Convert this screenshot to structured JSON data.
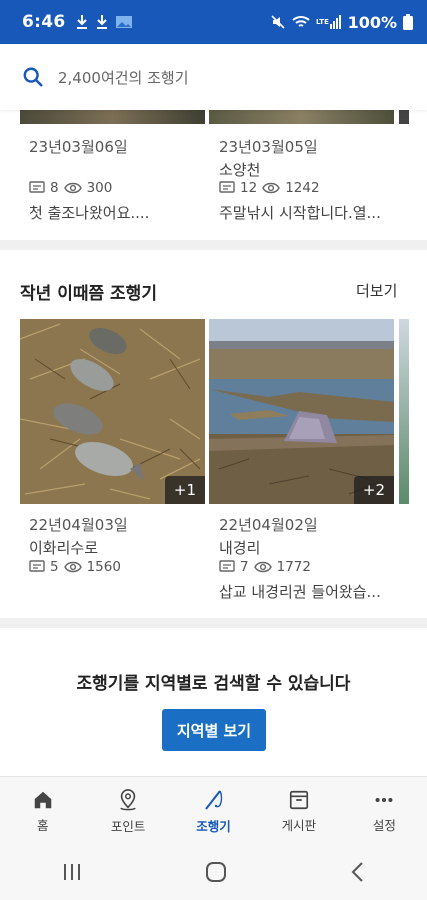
{
  "status": {
    "time": "6:46",
    "battery": "100%",
    "icons": [
      "download-icon",
      "download-icon",
      "gallery-icon",
      "mute-icon",
      "wifi-icon",
      "lte-signal-icon",
      "battery-icon"
    ]
  },
  "search": {
    "placeholder": "2,400여건의 조행기"
  },
  "recent": {
    "items": [
      {
        "date": "23년03월06일",
        "place": "",
        "comments": "8",
        "views": "300",
        "desc": "첫 출조나왔어요...."
      },
      {
        "date": "23년03월05일",
        "place": "소양천",
        "comments": "12",
        "views": "1242",
        "desc": "주말낚시 시작합니다.열..."
      }
    ]
  },
  "lastyear": {
    "title": "작년 이때쯤 조행기",
    "more": "더보기",
    "items": [
      {
        "badge": "+1",
        "date": "22년04월03일",
        "place": "이화리수로",
        "comments": "5",
        "views": "1560",
        "desc": ""
      },
      {
        "badge": "+2",
        "date": "22년04월02일",
        "place": "내경리",
        "comments": "7",
        "views": "1772",
        "desc": "삽교 내경리권 들어왔습..."
      }
    ]
  },
  "region": {
    "text": "조행기를 지역별로 검색할 수 있습니다",
    "button": "지역별 보기"
  },
  "nav": {
    "items": [
      {
        "label": "홈",
        "icon": "home-icon"
      },
      {
        "label": "포인트",
        "icon": "location-pin-icon"
      },
      {
        "label": "조행기",
        "icon": "fishing-rod-icon"
      },
      {
        "label": "게시판",
        "icon": "board-icon"
      },
      {
        "label": "설정",
        "icon": "more-dots-icon"
      }
    ],
    "active": "조행기"
  },
  "colors": {
    "brand": "#1858b8",
    "button": "#1a6fc4"
  }
}
